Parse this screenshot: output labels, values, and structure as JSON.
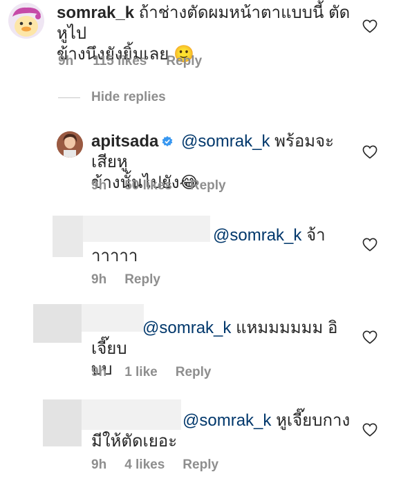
{
  "comments": [
    {
      "username": "somrak_k",
      "text_line1": "ถ้าช่างตัดผมหน้าตาแบบนี้ ตัดหูไป",
      "text_line2": "ข้างนึงยังยิ้มเลย",
      "emoji": "🙂",
      "time": "9h",
      "likes": "115 likes",
      "reply": "Reply"
    }
  ],
  "hide_replies": "Hide replies",
  "replies": [
    {
      "username": "apitsada",
      "mention": "@somrak_k",
      "text_line1": "พร้อมจะเสียหู",
      "text_line2": "ข้างนั้นไปยัง",
      "emoji": "😂",
      "time": "9h",
      "likes": "50 likes",
      "reply": "Reply"
    },
    {
      "mention": "@somrak_k",
      "text_line1": "จ้า",
      "text_line2": "าาาาา",
      "time": "9h",
      "reply": "Reply"
    },
    {
      "mention": "@somrak_k",
      "text_line1": "แหมมมมมม อิเจี๊ยบ",
      "text_line2": "บบ",
      "time": "9h",
      "likes": "1 like",
      "reply": "Reply"
    },
    {
      "mention": "@somrak_k",
      "text_line1": "หูเจี๊ยบกาง",
      "text_line2": "มีให้ตัดเยอะ",
      "time": "9h",
      "likes": "4 likes",
      "reply": "Reply"
    }
  ],
  "icons": {
    "heart": "heart-outline-icon",
    "verified": "verified-badge-icon"
  },
  "colors": {
    "mention": "#00376b",
    "meta": "#8e8e8e",
    "verified": "#3897f0"
  }
}
